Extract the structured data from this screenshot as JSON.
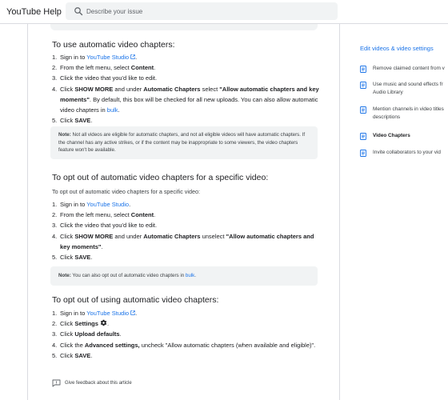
{
  "header": {
    "site_title": "YouTube Help",
    "search_placeholder": "Describe your issue"
  },
  "section1": {
    "title": "To use automatic video chapters:",
    "steps": [
      {
        "n": "1.",
        "pre": "Sign in to ",
        "link": "YouTube Studio",
        "post": "."
      },
      {
        "n": "2.",
        "pre": "From the left menu, select ",
        "bold": "Content",
        "post": "."
      },
      {
        "n": "3.",
        "text": "Click the video that you'd like to edit."
      },
      {
        "n": "4.",
        "a": "Click ",
        "b1": "SHOW MORE",
        "c": " and under ",
        "b2": "Automatic Chapters",
        "d": " select ",
        "b3": "\"Allow automatic chapters and key moments\"",
        "e": ". By default, this box will be checked for all new uploads. You can also allow automatic video chapters in ",
        "link": "bulk",
        "f": "."
      },
      {
        "n": "5.",
        "pre": "Click ",
        "bold": "SAVE",
        "post": "."
      }
    ],
    "note_label": "Note:",
    "note_text": " Not all videos are eligible for automatic chapters, and not all eligible videos will have automatic chapters. If the channel has any active strikes, or if the content may be inappropriate to some viewers, the video chapters feature won't be available."
  },
  "section2": {
    "title": "To opt out of automatic video chapters for a specific video:",
    "intro": "To opt out of automatic video chapters for a specific video:",
    "steps": [
      {
        "n": "1.",
        "pre": "Sign in to ",
        "link": "YouTube Studio",
        "post": "."
      },
      {
        "n": "2.",
        "pre": "From the left menu, select ",
        "bold": "Content",
        "post": "."
      },
      {
        "n": "3.",
        "text": "Click the video that you'd like to edit."
      },
      {
        "n": "4.",
        "a": "Click ",
        "b1": "SHOW MORE",
        "c": " and under ",
        "b2": "Automatic Chapters",
        "d": " unselect ",
        "b3": "\"Allow automatic chapters and key moments\"",
        "e": "."
      },
      {
        "n": "5.",
        "pre": "Click ",
        "bold": "SAVE",
        "post": "."
      }
    ],
    "note_label": "Note:",
    "note_text": " You can also opt out of automatic video chapters in ",
    "note_link": "bulk",
    "note_end": "."
  },
  "section3": {
    "title": "To opt out of using automatic video chapters:",
    "steps": [
      {
        "n": "1.",
        "pre": "Sign in to ",
        "link": "YouTube Studio",
        "post": "."
      },
      {
        "n": "2.",
        "pre": "Click ",
        "bold": "Settings",
        "post": "."
      },
      {
        "n": "3.",
        "pre": "Click ",
        "bold": "Upload defaults",
        "post": "."
      },
      {
        "n": "4.",
        "pre": "Click the ",
        "bold": "Advanced settings,",
        "post": " uncheck \"Allow automatic chapters (when available and eligible)\"."
      },
      {
        "n": "5.",
        "pre": "Click ",
        "bold": "SAVE",
        "post": "."
      }
    ]
  },
  "feedback": {
    "label": "Give feedback about this article"
  },
  "sidebar": {
    "title": "Edit videos & video settings",
    "items": [
      {
        "label": "Remove claimed content from v"
      },
      {
        "label": "Use music and sound effects fr Audio Library"
      },
      {
        "label": "Mention channels in video titles descriptions"
      },
      {
        "label": "Video Chapters"
      },
      {
        "label": "Invite collaborators to your vid"
      }
    ]
  },
  "colors": {
    "link": "#1a73e8",
    "note_bg": "#f1f3f4",
    "divider": "#dadce0"
  }
}
